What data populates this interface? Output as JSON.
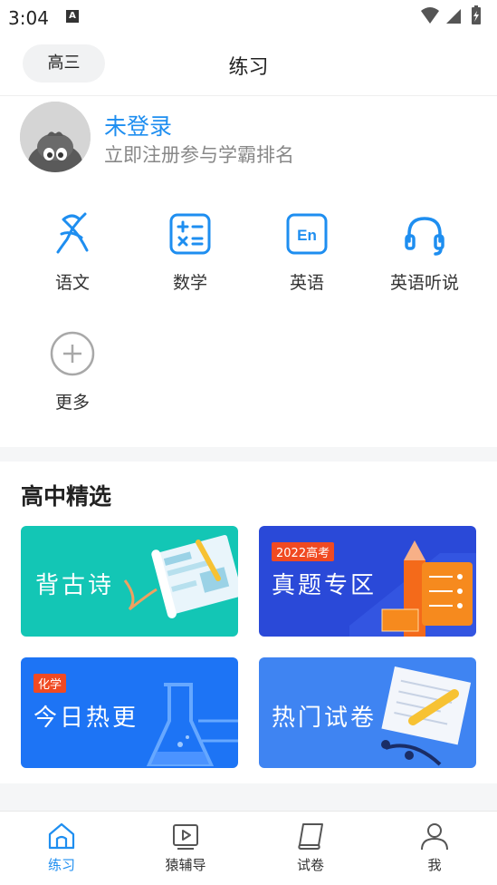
{
  "status_bar": {
    "time": "3:04",
    "notification_badge": "A"
  },
  "header": {
    "grade_button": "高三",
    "title": "练习"
  },
  "profile": {
    "title": "未登录",
    "subtitle": "立即注册参与学霸排名"
  },
  "subjects": [
    {
      "label": "语文",
      "icon": "chinese-icon"
    },
    {
      "label": "数学",
      "icon": "math-icon"
    },
    {
      "label": "英语",
      "icon": "english-icon",
      "icon_text": "En"
    },
    {
      "label": "英语听说",
      "icon": "headphones-icon"
    },
    {
      "label": "更多",
      "icon": "plus-icon"
    }
  ],
  "selection": {
    "title": "高中精选",
    "cards": [
      {
        "title": "背古诗",
        "color": "#13c6b5"
      },
      {
        "title": "真题专区",
        "tag": "2022高考",
        "color": "#2a49d8"
      },
      {
        "title": "今日热更",
        "tag": "化学",
        "color": "#1d74f5"
      },
      {
        "title": "热门试卷",
        "color": "#3f84f2"
      }
    ]
  },
  "bottom_nav": [
    {
      "label": "练习",
      "active": true
    },
    {
      "label": "猿辅导",
      "active": false
    },
    {
      "label": "试卷",
      "active": false
    },
    {
      "label": "我",
      "active": false
    }
  ],
  "colors": {
    "accent": "#1e8ef0",
    "muted": "#888888"
  }
}
